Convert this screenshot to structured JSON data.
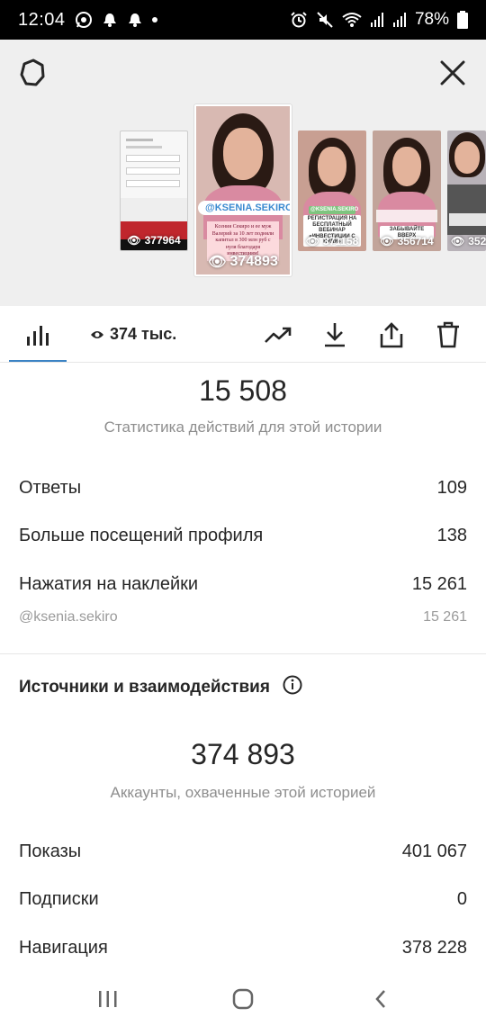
{
  "status_bar": {
    "time": "12:04",
    "battery": "78%"
  },
  "stories": [
    {
      "views": "377964"
    },
    {
      "views": "374893",
      "tag": "@KSENIA.SEKIRO",
      "caption": "Ксения Секиро и ее муж Валерий за 10 лет подняли капитал в 300 млн руб с нуля благодаря инвестициям!"
    },
    {
      "views": "371158",
      "tag": "@KSENIA.SEKIRO",
      "caption": "РЕГИСТРАЦИЯ НА БЕСПЛАТНЫЙ ВЕБИНАР «ИНВЕСТИЦИИ С НУЛЯ»"
    },
    {
      "views": "356714",
      "caption": "ЗАБЫВАЙТЕ ВВЕРХ"
    },
    {
      "views": "352"
    }
  ],
  "toolbar": {
    "views_label": "374 тыс."
  },
  "actions": {
    "total": "15 508",
    "caption": "Статистика действий для этой истории",
    "rows": [
      {
        "label": "Ответы",
        "value": "109"
      },
      {
        "label": "Больше посещений профиля",
        "value": "138"
      },
      {
        "label": "Нажатия на наклейки",
        "value": "15 261"
      }
    ],
    "sub_row": {
      "label": "@ksenia.sekiro",
      "value": "15 261"
    }
  },
  "sources": {
    "title": "Источники и взаимодействия",
    "total": "374 893",
    "caption": "Аккаунты, охваченные этой историей",
    "rows": [
      {
        "label": "Показы",
        "value": "401 067"
      },
      {
        "label": "Подписки",
        "value": "0"
      },
      {
        "label": "Навигация",
        "value": "378 228"
      }
    ]
  },
  "colors": {
    "accent": "#3b83c4",
    "top_background": "#efefef",
    "muted_text": "#8e8e8e"
  },
  "icons": [
    "whatsapp-icon",
    "alarm-icon",
    "alarm-icon",
    "alarm-icon",
    "mute-icon",
    "wifi-icon",
    "signal-icon",
    "signal-icon",
    "battery-icon",
    "settings-icon",
    "close-icon",
    "bar-chart-icon",
    "eye-icon",
    "trending-icon",
    "download-icon",
    "share-icon",
    "trash-icon",
    "info-icon",
    "recents-icon",
    "home-icon",
    "back-icon"
  ]
}
